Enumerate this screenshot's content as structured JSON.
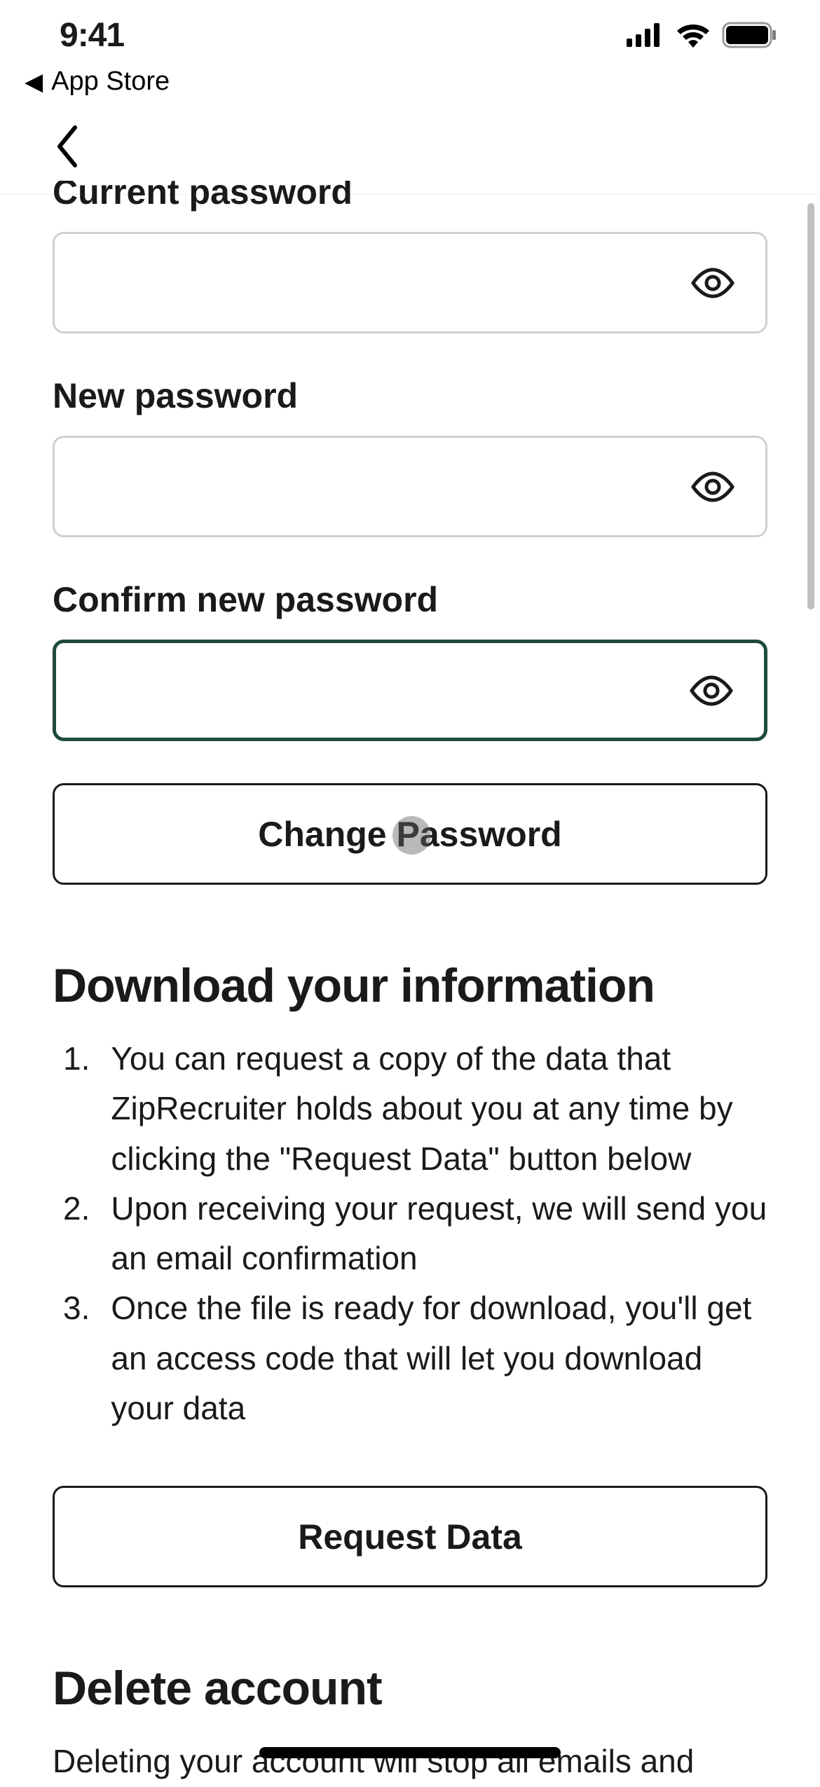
{
  "status_bar": {
    "time": "9:41",
    "back_app": "App Store"
  },
  "form": {
    "current_password_label": "Current password",
    "new_password_label": "New password",
    "confirm_password_label": "Confirm new password",
    "change_password_button": "Change Password"
  },
  "download_section": {
    "heading": "Download your information",
    "items": [
      "You can request a copy of the data that ZipRecruiter holds about you at any time by clicking the \"Request Data\" button below",
      "Upon receiving your request, we will send you an email confirmation",
      "Once the file is ready for download, you'll get an access code that will let you download your data"
    ],
    "request_button": "Request Data"
  },
  "delete_section": {
    "heading": "Delete account",
    "body": "Deleting your account will stop all emails and"
  }
}
